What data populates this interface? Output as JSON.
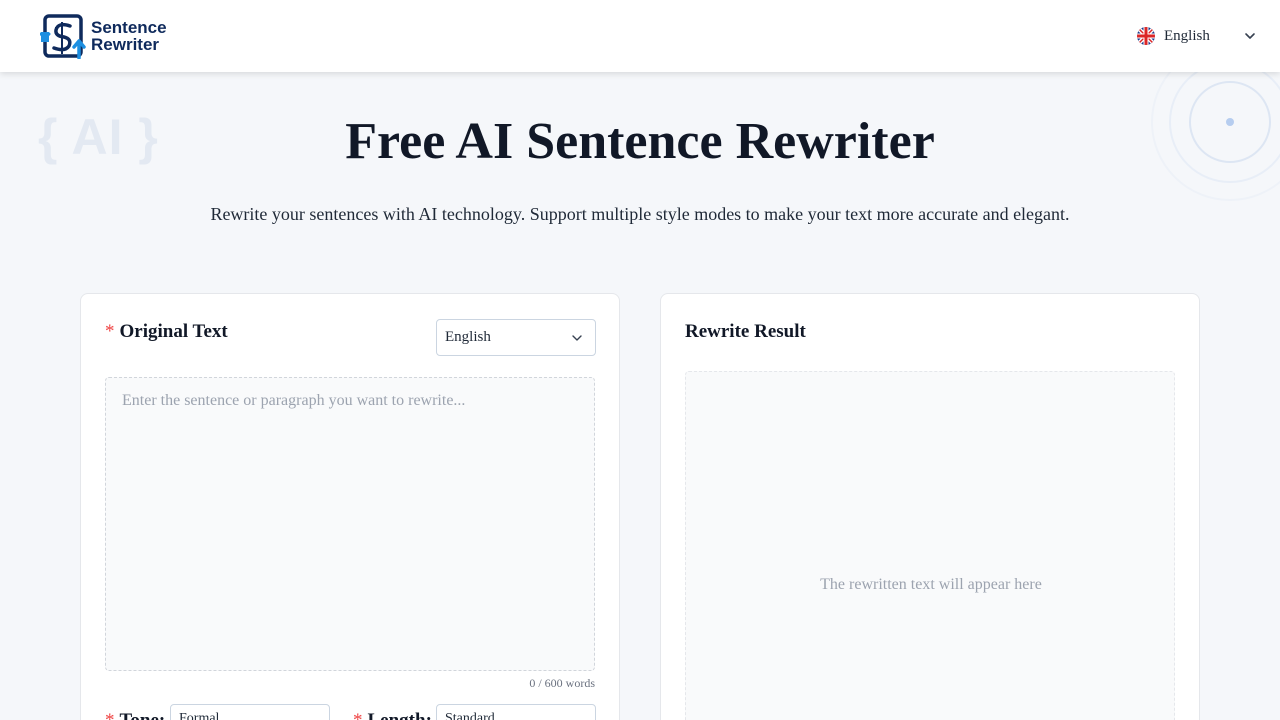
{
  "header": {
    "logo": {
      "line1": "Sentence",
      "line2": "Rewriter"
    },
    "language": {
      "label": "English",
      "flag_icon": "uk-flag-icon"
    }
  },
  "decoration": {
    "ai_text": "{ AI }"
  },
  "hero": {
    "title": "Free AI Sentence Rewriter",
    "subtitle": "Rewrite your sentences with AI technology. Support multiple style modes to make your text more accurate and elegant."
  },
  "original": {
    "required_mark": "*",
    "label": "Original Text",
    "language_select": "English",
    "placeholder": "Enter the sentence or paragraph you want to rewrite...",
    "value": "",
    "word_count": "0 / 600 words"
  },
  "options": {
    "tone_label": "Tone:",
    "tone_value": "Formal",
    "length_label": "Length:",
    "length_value": "Standard"
  },
  "result": {
    "label": "Rewrite Result",
    "placeholder": "The rewritten text will appear here"
  },
  "colors": {
    "accent": "#1d8fe1",
    "brand_dark": "#0f2a5c",
    "required": "#ef4444",
    "background": "#f5f7fa"
  }
}
